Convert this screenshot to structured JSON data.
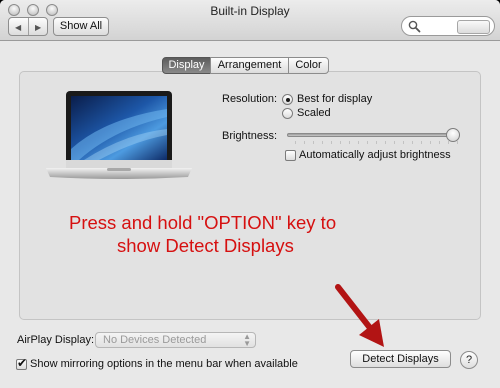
{
  "window": {
    "title": "Built-in Display",
    "show_all_label": "Show All"
  },
  "tabs": [
    {
      "label": "Display",
      "active": true
    },
    {
      "label": "Arrangement",
      "active": false
    },
    {
      "label": "Color",
      "active": false
    }
  ],
  "display": {
    "resolution_label": "Resolution:",
    "resolution_options": [
      {
        "label": "Best for display",
        "selected": true
      },
      {
        "label": "Scaled",
        "selected": false
      }
    ],
    "brightness_label": "Brightness:",
    "brightness_level": 1.0,
    "auto_brightness_label": "Automatically adjust brightness",
    "auto_brightness_checked": false
  },
  "annotation": {
    "line1": "Press and hold \"OPTION\" key to",
    "line2": "show Detect Displays",
    "color": "#d61010"
  },
  "bottom": {
    "airplay_label": "AirPlay Display:",
    "airplay_value": "No Devices Detected",
    "mirroring_label": "Show mirroring options in the menu bar when available",
    "mirroring_checked": true,
    "detect_label": "Detect Displays",
    "help_label": "?"
  },
  "icons": {
    "laptop": "macbook-air-icon",
    "arrow": "red-arrow-icon"
  }
}
